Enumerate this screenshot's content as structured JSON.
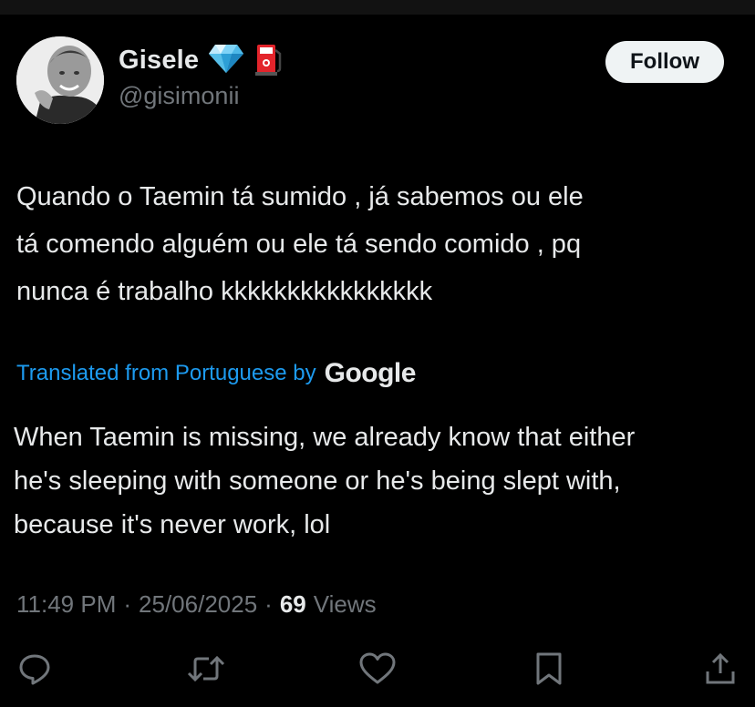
{
  "user": {
    "display_name": "Gisele",
    "handle": "@gisimonii",
    "badges": [
      "gem-emoji-icon",
      "fuel-pump-emoji-icon"
    ],
    "avatar": "profile-photo"
  },
  "follow_button": {
    "label": "Follow"
  },
  "tweet": {
    "text_lines": [
      "Quando o Taemin tá sumido , já sabemos ou ele",
      "tá comendo alguém ou ele tá sendo comido , pq",
      "nunca é trabalho kkkkkkkkkkkkkkkk"
    ]
  },
  "translation": {
    "label": "Translated from Portuguese by",
    "provider": "Google",
    "text_lines": [
      "When Taemin is missing, we already know that either",
      "he's sleeping with someone or he's being slept with,",
      "because it's never work, lol"
    ]
  },
  "meta": {
    "time": "11:49 PM",
    "separator": "·",
    "date": "25/06/2025",
    "views_count": "69",
    "views_label": "Views"
  },
  "actions": [
    "reply-icon",
    "retweet-icon",
    "like-icon",
    "bookmark-icon",
    "share-icon"
  ],
  "colors": {
    "background": "#000000",
    "text": "#e7e9ea",
    "secondary_text": "#71767b",
    "link": "#1d9bf0",
    "follow_bg": "#eff3f4"
  }
}
